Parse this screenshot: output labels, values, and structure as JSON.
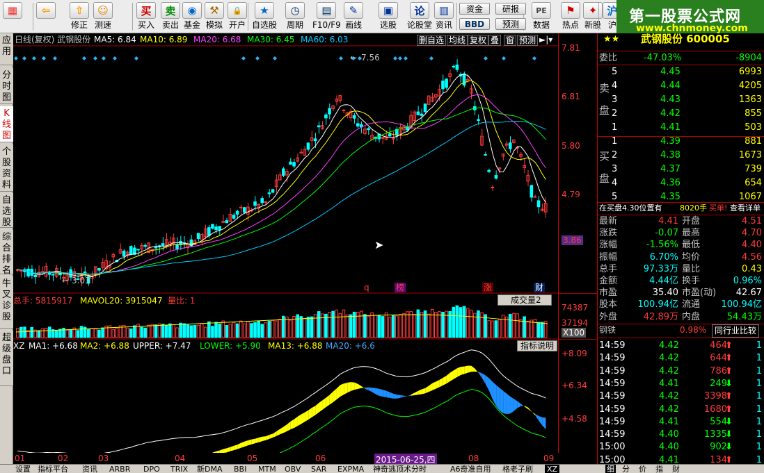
{
  "toolbar": {
    "buttons": [
      {
        "name": "view-switch-button",
        "label": ""
      },
      {
        "name": "back-button",
        "label": ""
      },
      {
        "name": "modify-button",
        "label": "修正"
      },
      {
        "name": "measure-button",
        "label": "测速"
      },
      {
        "name": "buy-button",
        "label": "买入"
      },
      {
        "name": "sell-button",
        "label": "卖出"
      },
      {
        "name": "fund-button",
        "label": "基金"
      },
      {
        "name": "simulate-button",
        "label": "模拟"
      },
      {
        "name": "open-account-button",
        "label": "开户"
      },
      {
        "name": "watchlist-button",
        "label": "自选股"
      },
      {
        "name": "period-button",
        "label": "周期"
      },
      {
        "name": "f10-button",
        "label": "F10/F9"
      },
      {
        "name": "draw-line-button",
        "label": "画线"
      },
      {
        "name": "select-stock-button",
        "label": "选股"
      },
      {
        "name": "stock-forum-button",
        "label": "论股堂"
      },
      {
        "name": "news-button",
        "label": "资讯"
      },
      {
        "name": "data-button",
        "label": "数据"
      },
      {
        "name": "hot-button",
        "label": "热点"
      },
      {
        "name": "new-stock-button",
        "label": "新股"
      },
      {
        "name": "shanghai-button",
        "label": "沪"
      }
    ],
    "small_buttons": {
      "fund_flow": "资金",
      "research": "研报",
      "bbd": "BBD",
      "forecast": "预测"
    },
    "watermark_title": "第一股票公式网",
    "watermark_url": "www.chnmoney.com"
  },
  "left_tabs": [
    "应用",
    "分时图",
    "K线图",
    "个股资料",
    "自选股",
    "综合排名",
    "牛叉诊股",
    "超级盘口"
  ],
  "chart": {
    "header_title": "日线(复权)  武钢股份",
    "ma": [
      {
        "label": "MA5: 6.84",
        "color": "#ffffff"
      },
      {
        "label": "MA10: 6.89",
        "color": "#ffff00"
      },
      {
        "label": "MA20: 6.68",
        "color": "#ff40ff"
      },
      {
        "label": "MA30: 6.45",
        "color": "#00ff00"
      },
      {
        "label": "MA60: 6.03",
        "color": "#00ccff"
      }
    ],
    "header_buttons": [
      "删自选",
      "均线",
      "复权",
      "叠",
      "窗",
      "预测"
    ],
    "price_scale": [
      "7.81",
      "6.81",
      "5.80",
      "4.79",
      "3.86"
    ],
    "high_label": "7.56",
    "low_label": "3.03",
    "event_marks": [
      {
        "text": "q",
        "color": "#ff3c3c"
      },
      {
        "text": "榜",
        "color": "#ff3c3c"
      },
      {
        "text": "涨",
        "color": "#ff3c3c"
      },
      {
        "text": "财",
        "color": "#ffffff"
      }
    ],
    "volume_header": {
      "total": "总手: 5815917",
      "mavol": "MAVOL20: 3915047",
      "ratio": "量比: 1"
    },
    "volume_selector": "成交量2",
    "volume_scale": [
      "74387",
      "37194",
      "X100"
    ],
    "indicator_header": {
      "name": "XZ",
      "ma1": "MA1: +6.68",
      "ma2": "MA2: +6.88",
      "upper": "UPPER: +7.47",
      "lower": "LOWER: +5.90",
      "ma13": "MA13: +6.88",
      "ma20": "MA20: +6.6"
    },
    "indicator_button": "指标说明",
    "indicator_scale": [
      "+8.09",
      "+6.34",
      "+4.58"
    ],
    "x_axis": [
      "01",
      "02",
      "03",
      "04",
      "05",
      "06",
      "07",
      "08",
      "09"
    ],
    "cursor_date": "2015-06-25,四"
  },
  "quote": {
    "stock_title": "武钢股份 600005",
    "weibi": {
      "label": "委比",
      "pct": "-47.03%",
      "diff": "-8904"
    },
    "sell_label": [
      "卖",
      "盘"
    ],
    "buy_label": [
      "买",
      "盘"
    ],
    "asks": [
      {
        "lvl": "5",
        "price": "4.45",
        "vol": "6993"
      },
      {
        "lvl": "4",
        "price": "4.44",
        "vol": "4205"
      },
      {
        "lvl": "3",
        "price": "4.43",
        "vol": "1363"
      },
      {
        "lvl": "2",
        "price": "4.42",
        "vol": "855"
      },
      {
        "lvl": "1",
        "price": "4.41",
        "vol": "503"
      }
    ],
    "bids": [
      {
        "lvl": "1",
        "price": "4.39",
        "vol": "881"
      },
      {
        "lvl": "2",
        "price": "4.38",
        "vol": "1673"
      },
      {
        "lvl": "3",
        "price": "4.37",
        "vol": "739"
      },
      {
        "lvl": "4",
        "price": "4.36",
        "vol": "654"
      },
      {
        "lvl": "5",
        "price": "4.35",
        "vol": "1067"
      }
    ],
    "notice": {
      "text": "在买盘4.30位置有",
      "qty": "8020手",
      "tail": "买单!",
      "link": "查看详单"
    },
    "stats": [
      {
        "l1": "最新",
        "v1": "4.41",
        "l2": "开盘",
        "v2": "4.51",
        "c1": "#ff3c3c",
        "c2": "#ff3c3c"
      },
      {
        "l1": "涨跌",
        "v1": "-0.07",
        "l2": "最高",
        "v2": "4.70",
        "c1": "#00ff00",
        "c2": "#ff3c3c"
      },
      {
        "l1": "涨幅",
        "v1": "-1.56%",
        "l2": "最低",
        "v2": "4.40",
        "c1": "#00ff00",
        "c2": "#ff3c3c"
      },
      {
        "l1": "振幅",
        "v1": "6.70%",
        "l2": "均价",
        "v2": "4.56",
        "c1": "#00ffff",
        "c2": "#ff3c3c"
      },
      {
        "l1": "总手",
        "v1": "97.33万",
        "l2": "量比",
        "v2": "0.43",
        "c1": "#00ffff",
        "c2": "#ff0"
      },
      {
        "l1": "金额",
        "v1": "4.44亿",
        "l2": "换手",
        "v2": "0.96%",
        "c1": "#00ffff",
        "c2": "#00ffff"
      },
      {
        "l1": "市盈",
        "v1": "35.40",
        "l2": "市盈(动)",
        "v2": "42.67",
        "c1": "#ffffff",
        "c2": "#ffffff"
      },
      {
        "l1": "股本",
        "v1": "100.94亿",
        "l2": "流通",
        "v2": "100.94亿",
        "c1": "#00ffff",
        "c2": "#00ffff"
      },
      {
        "l1": "外盘",
        "v1": "42.89万",
        "l2": "内盘",
        "v2": "54.43万",
        "c1": "#ff3c3c",
        "c2": "#00ff00"
      }
    ],
    "industry": {
      "name": "钢铁",
      "pct": "0.98%",
      "btn": "同行业比较"
    },
    "ticks": [
      {
        "t": "14:59",
        "p": "4.42",
        "v": "464",
        "dir": "up",
        "n": "1"
      },
      {
        "t": "14:59",
        "p": "4.42",
        "v": "644",
        "dir": "up",
        "n": "1"
      },
      {
        "t": "14:59",
        "p": "4.42",
        "v": "786",
        "dir": "up",
        "n": "1"
      },
      {
        "t": "14:59",
        "p": "4.41",
        "v": "249",
        "dir": "down",
        "n": "1"
      },
      {
        "t": "14:59",
        "p": "4.42",
        "v": "3398",
        "dir": "up",
        "n": "1"
      },
      {
        "t": "14:59",
        "p": "4.42",
        "v": "1680",
        "dir": "up",
        "n": "1"
      },
      {
        "t": "14:59",
        "p": "4.41",
        "v": "554",
        "dir": "down",
        "n": "1"
      },
      {
        "t": "14:59",
        "p": "4.40",
        "v": "1335",
        "dir": "down",
        "n": "1"
      },
      {
        "t": "15:00",
        "p": "4.40",
        "v": "902",
        "dir": "down",
        "n": "1"
      },
      {
        "t": "15:00",
        "p": "4.41",
        "v": "134",
        "dir": "up",
        "n": "1"
      }
    ]
  },
  "bottom_tabs": [
    "设置",
    "指标平台",
    "资讯",
    "ARBR",
    "DPO",
    "TRIX",
    "新DMA",
    "BBI",
    "MTM",
    "OBV",
    "SAR",
    "EXPMA",
    "神奇逃顶术分时",
    "A6奇准自用",
    "格老子刷",
    "XZ"
  ],
  "right_bottom_tabs": [
    "细",
    "分",
    "价",
    "指",
    "财"
  ],
  "colors": {
    "up": "#ff3c3c",
    "down": "#00ff00",
    "grid": "#a00000",
    "bg": "#000000"
  }
}
